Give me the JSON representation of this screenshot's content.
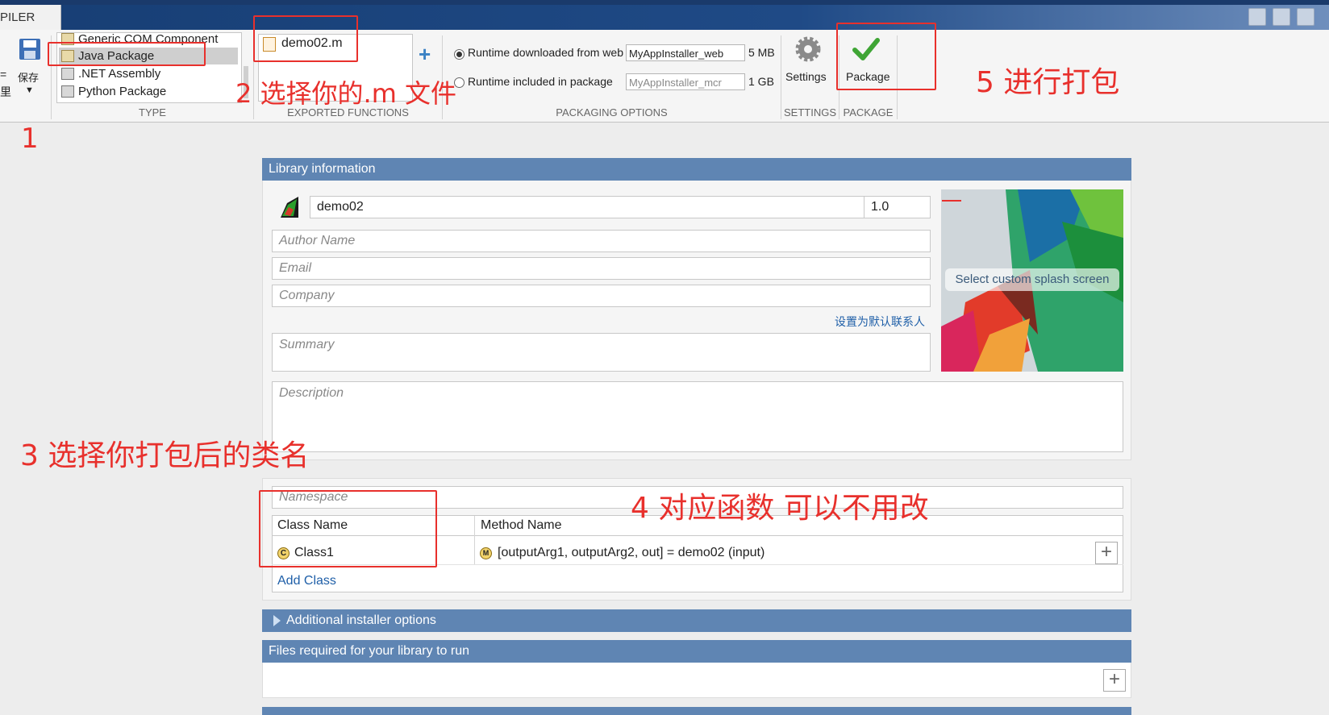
{
  "ribbon": {
    "tab_label": "PILER",
    "save_label": "保存",
    "left_edge_fragments": [
      "=",
      "里"
    ],
    "type_list": [
      "Generic COM Component",
      "Java Package",
      ".NET Assembly",
      "Python Package"
    ],
    "exported_function": "demo02.m",
    "packaging": {
      "web_option": "Runtime downloaded from web",
      "web_name": "MyAppInstaller_web",
      "web_size": "5 MB",
      "included_option": "Runtime included in package",
      "included_name": "MyAppInstaller_mcr",
      "included_size": "1 GB"
    },
    "settings_label": "Settings",
    "package_label": "Package",
    "section_labels": {
      "type": "TYPE",
      "exported": "EXPORTED FUNCTIONS",
      "packaging": "PACKAGING OPTIONS",
      "settings": "SETTINGS",
      "package": "PACKAGE"
    }
  },
  "library_info": {
    "header": "Library information",
    "name": "demo02",
    "version": "1.0",
    "author_placeholder": "Author Name",
    "email_placeholder": "Email",
    "company_placeholder": "Company",
    "default_contact_link": "设置为默认联系人",
    "summary_placeholder": "Summary",
    "description_placeholder": "Description",
    "splash_label": "Select custom splash screen"
  },
  "class_section": {
    "namespace_placeholder": "Namespace",
    "col_class": "Class Name",
    "col_method": "Method Name",
    "class_name": "Class1",
    "method_signature": "[outputArg1, outputArg2, out] = demo02 (input)",
    "add_class": "Add Class"
  },
  "installer_header": "Additional installer options",
  "files_header": "Files required for your library to run",
  "annotations": {
    "a1": "1",
    "a2": "2 选择你的.m 文件",
    "a3": "3 选择你打包后的类名",
    "a4": "4 对应函数 可以不用改",
    "a5": "5 进行打包"
  },
  "colors": {
    "accent_header": "#5f85b3",
    "annotation_red": "#e8302c",
    "link_blue": "#1f5fa8",
    "ribbon_title_bar": "#1f4a86"
  }
}
